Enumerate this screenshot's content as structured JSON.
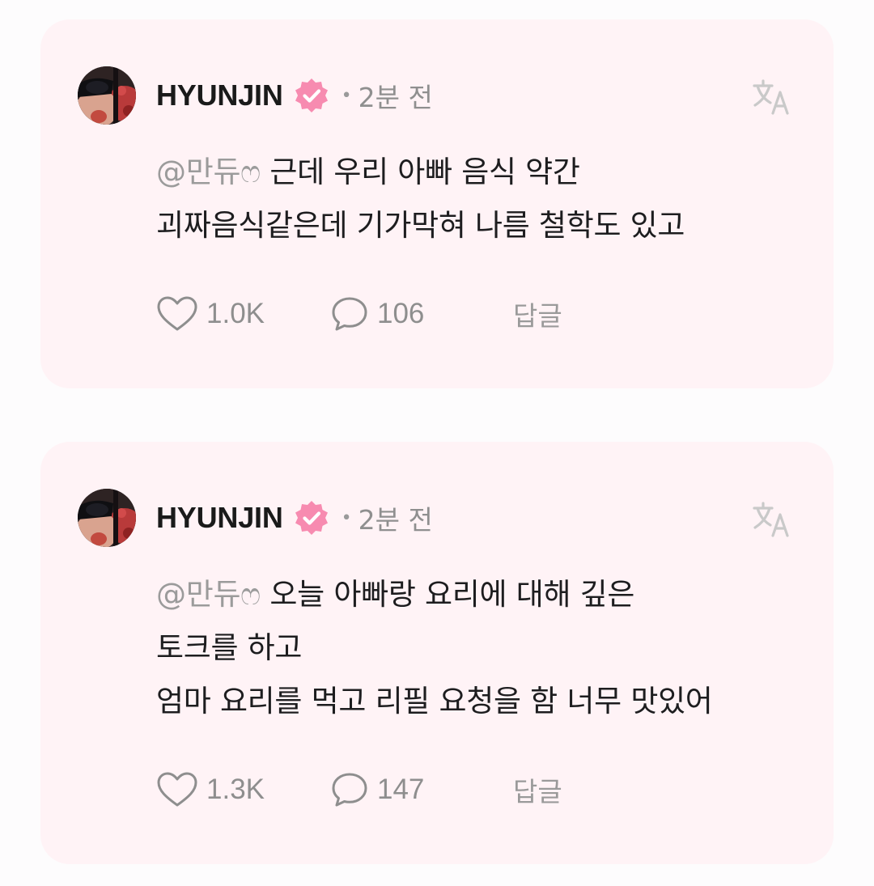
{
  "posts": [
    {
      "author": "HYUNJIN",
      "time": "2분 전",
      "mention": "@만듀ෆ",
      "lines": [
        "근데 우리 아빠 음식 약간",
        "괴짜음식같은데 기가막혀 나름 철학도 있고"
      ],
      "likes": "1.0K",
      "comments": "106",
      "reply_label": "답글"
    },
    {
      "author": "HYUNJIN",
      "time": "2분 전",
      "mention": "@만듀ෆ",
      "lines": [
        "오늘 아빠랑 요리에 대해 깊은",
        "토크를 하고",
        "엄마 요리를 먹고 리필 요청을 함 너무 맛있어"
      ],
      "likes": "1.3K",
      "comments": "147",
      "reply_label": "답글"
    }
  ],
  "colors": {
    "card_background": "#fff3f6",
    "page_background": "#fdfcfd",
    "verified_badge": "#f78bb0",
    "muted_text": "#8f8f8f"
  },
  "icons": {
    "verified": "verified-badge-icon",
    "translate": "translate-icon",
    "like": "heart-icon",
    "comment": "speech-bubble-icon"
  }
}
